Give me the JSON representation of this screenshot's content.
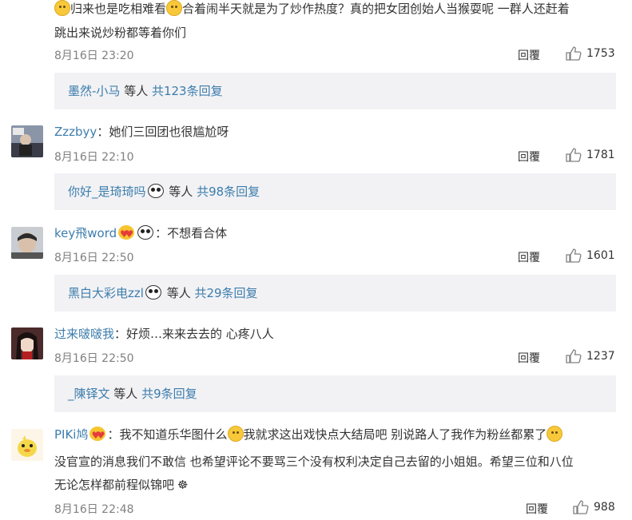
{
  "comments": [
    {
      "line1": "归来也是吃相难看",
      "line1b": "合着闹半天就是为了炒作热度？真的把女团创始人当猴耍呢 一群人还赶着",
      "line2": "跳出来说炒粉都等着你们",
      "time": "8月16日 23:20",
      "reply_label": "回覆",
      "likes": "1753",
      "thread": {
        "user": "墨然-小马",
        "mid": " 等人 ",
        "count": "共123条回复"
      }
    },
    {
      "user": "Zzzbyy",
      "text": "：她们三回团也很尴尬呀",
      "time": "8月16日 22:10",
      "reply_label": "回覆",
      "likes": "1781",
      "thread": {
        "user": "你好_是琦琦吗",
        "mid": " 等人 ",
        "count": "共98条回复"
      }
    },
    {
      "user": "key飛word",
      "text": "：不想看合体",
      "time": "8月16日 22:50",
      "reply_label": "回覆",
      "likes": "1601",
      "thread": {
        "user": "黑白大彩电zzl",
        "mid": " 等人 ",
        "count": "共29条回复"
      }
    },
    {
      "user": "过来啵啵我",
      "text": "：好烦…来来去去的 心疼八人",
      "time": "8月16日 22:50",
      "reply_label": "回覆",
      "likes": "1237",
      "thread": {
        "user": "_陳铎文",
        "mid": " 等人 ",
        "count": "共9条回复"
      }
    },
    {
      "user": "PIKi鸠",
      "text_a": "：我不知道乐华图什么",
      "text_b": "我就求这出戏快点大结局吧 别说路人了我作为粉丝都累了",
      "line2": "没官宣的消息我们不敢信 也希望评论不要骂三个没有权利决定自己去留的小姐姐。希望三位和八位",
      "line3": "无论怎样都前程似锦吧",
      "time": "8月16日 22:48",
      "reply_label": "回覆",
      "likes": "988"
    }
  ],
  "icons": {
    "like": "thumbs-up-icon",
    "emoji": "smile-emoji-icon",
    "panda": "panda-emoji-icon"
  },
  "colors": {
    "link": "#3d7dac",
    "reply_bg": "#f2f2f5",
    "meta": "#808080"
  }
}
